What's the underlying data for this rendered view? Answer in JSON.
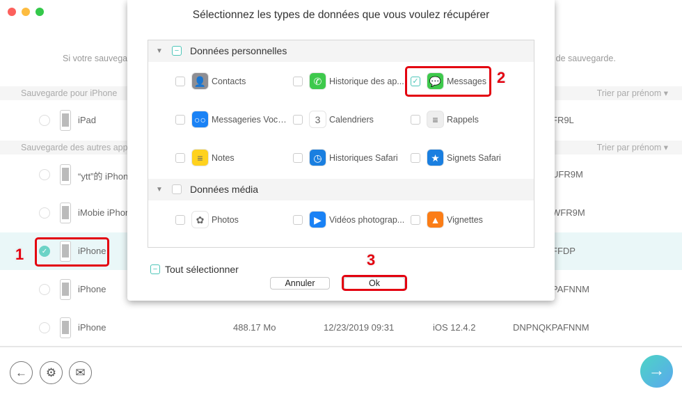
{
  "window": {
    "controls": [
      "close",
      "minimize",
      "maximize"
    ]
  },
  "hint": {
    "left": "Si votre sauvega",
    "right": "r de sauvegarde."
  },
  "groups": [
    {
      "label": "Sauvegarde pour iPhone",
      "sort": "Trier par prénom ▾"
    },
    {
      "label": "Sauvegarde des autres app",
      "sort": "Trier par prénom ▾"
    }
  ],
  "rows": [
    {
      "name": "iPad",
      "id": "FR9L",
      "selected": false
    },
    {
      "name": "“ytt”的 iPhon",
      "id": "UFR9M",
      "selected": false
    },
    {
      "name": "iMobie iPhon",
      "id": "WFR9M",
      "selected": false
    },
    {
      "name": "iPhone",
      "id": "FFDP",
      "selected": true
    },
    {
      "name": "iPhone",
      "id": "PAFNNM",
      "selected": false
    },
    {
      "name": "iPhone",
      "size": "488.17 Mo",
      "date": "12/23/2019 09:31",
      "ios": "iOS 12.4.2",
      "id": "DNPNQKPAFNNM",
      "selected": false
    }
  ],
  "dialog": {
    "title": "Sélectionnez les types de données que vous voulez récupérer",
    "sections": [
      {
        "label": "Données personnelles",
        "state": "partial",
        "items": [
          {
            "label": "Contacts",
            "icon": "contacts-icon",
            "color": "#8e8e93",
            "checked": false
          },
          {
            "label": "Historique des ap...",
            "icon": "phone-icon",
            "color": "#3ec94c",
            "checked": false
          },
          {
            "label": "Messages",
            "icon": "messages-icon",
            "color": "#3ec94c",
            "checked": true
          },
          {
            "label": "Messageries Voca...",
            "icon": "voicemail-icon",
            "color": "#1a82f5",
            "checked": false
          },
          {
            "label": "Calendriers",
            "icon": "calendar-icon",
            "color": "#ffffff",
            "checked": false
          },
          {
            "label": "Rappels",
            "icon": "reminders-icon",
            "color": "#eeeeee",
            "checked": false
          },
          {
            "label": "Notes",
            "icon": "notes-icon",
            "color": "#ffd21e",
            "checked": false
          },
          {
            "label": "Historiques Safari",
            "icon": "safari-history-icon",
            "color": "#1a7fe0",
            "checked": false
          },
          {
            "label": "Signets Safari",
            "icon": "safari-bookmarks-icon",
            "color": "#1a7fe0",
            "checked": false
          }
        ]
      },
      {
        "label": "Données média",
        "state": "unchecked",
        "items": [
          {
            "label": "Photos",
            "icon": "photos-icon",
            "color": "#ffffff",
            "checked": false
          },
          {
            "label": "Vidéos photograp...",
            "icon": "video-icon",
            "color": "#1a82f5",
            "checked": false
          },
          {
            "label": "Vignettes",
            "icon": "thumbnails-icon",
            "color": "#fb7d16",
            "checked": false
          }
        ]
      }
    ],
    "select_all": "Tout sélectionner",
    "cancel": "Annuler",
    "ok": "Ok"
  },
  "annotations": [
    "1",
    "2",
    "3"
  ],
  "footer": {
    "back": "←",
    "settings": "⚙",
    "mail": "✉",
    "next": "→"
  }
}
